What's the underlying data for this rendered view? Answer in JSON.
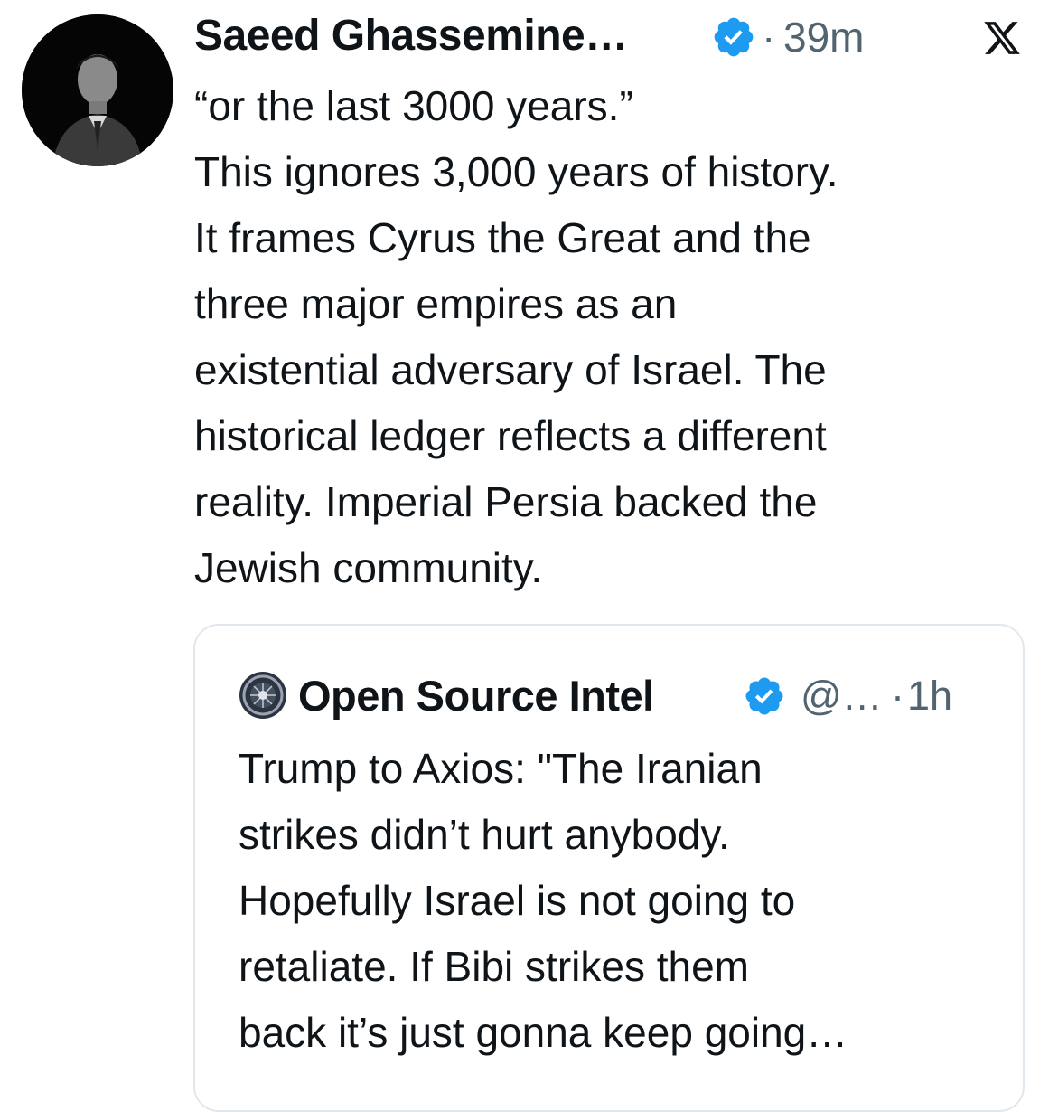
{
  "tweet": {
    "author_name": "Saeed Ghassemine…",
    "verified_icon": "verified-badge-icon",
    "separator": "·",
    "timestamp": "39m",
    "platform_icon": "x-logo-icon",
    "text_lines": [
      "“or the last 3000 years.”",
      "This ignores 3,000 years of history.",
      "It frames Cyrus the Great and the",
      "three major empires as an",
      "existential adversary of Israel. The",
      "historical ledger reflects a different",
      "reality. Imperial Persia backed the",
      "Jewish community."
    ]
  },
  "quote": {
    "author_name": "Open Source Intel",
    "verified_icon": "verified-badge-icon",
    "handle": "@…",
    "separator": "·",
    "timestamp": "1h",
    "text_lines": [
      "Trump to Axios: \"The Iranian",
      "strikes didn’t hurt anybody.",
      "Hopefully Israel is not going to",
      "retaliate. If Bibi strikes them",
      "back it’s just gonna keep going…"
    ]
  },
  "colors": {
    "verified_blue": "#1d9bf0",
    "secondary_text": "#536471",
    "primary_text": "#0f1419",
    "card_border": "#e1e8ed"
  }
}
